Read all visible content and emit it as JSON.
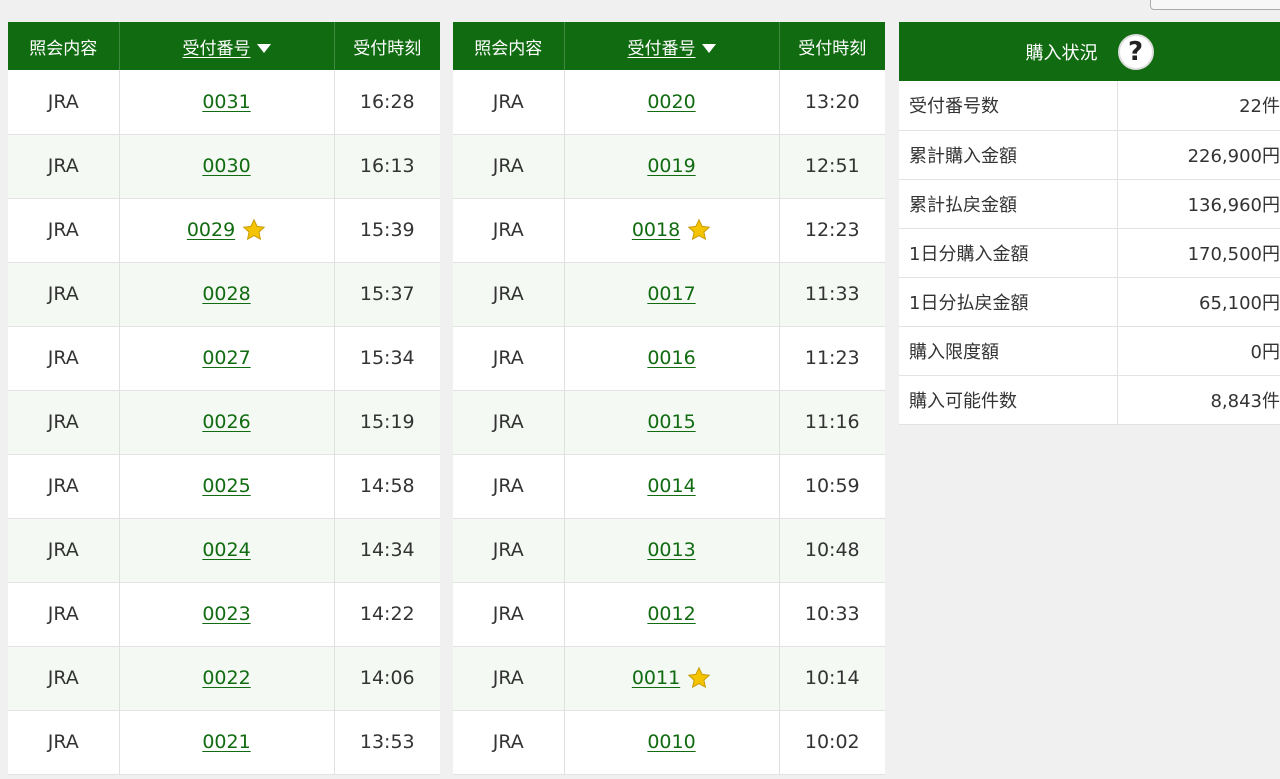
{
  "columns": {
    "inquiry": "照会内容",
    "receipt_number": "受付番号",
    "receipt_time": "受付時刻"
  },
  "left_rows": [
    {
      "type": "JRA",
      "number": "0031",
      "time": "16:28",
      "star": false
    },
    {
      "type": "JRA",
      "number": "0030",
      "time": "16:13",
      "star": false
    },
    {
      "type": "JRA",
      "number": "0029",
      "time": "15:39",
      "star": true
    },
    {
      "type": "JRA",
      "number": "0028",
      "time": "15:37",
      "star": false
    },
    {
      "type": "JRA",
      "number": "0027",
      "time": "15:34",
      "star": false
    },
    {
      "type": "JRA",
      "number": "0026",
      "time": "15:19",
      "star": false
    },
    {
      "type": "JRA",
      "number": "0025",
      "time": "14:58",
      "star": false
    },
    {
      "type": "JRA",
      "number": "0024",
      "time": "14:34",
      "star": false
    },
    {
      "type": "JRA",
      "number": "0023",
      "time": "14:22",
      "star": false
    },
    {
      "type": "JRA",
      "number": "0022",
      "time": "14:06",
      "star": false
    },
    {
      "type": "JRA",
      "number": "0021",
      "time": "13:53",
      "star": false
    }
  ],
  "right_rows": [
    {
      "type": "JRA",
      "number": "0020",
      "time": "13:20",
      "star": false
    },
    {
      "type": "JRA",
      "number": "0019",
      "time": "12:51",
      "star": false
    },
    {
      "type": "JRA",
      "number": "0018",
      "time": "12:23",
      "star": true
    },
    {
      "type": "JRA",
      "number": "0017",
      "time": "11:33",
      "star": false
    },
    {
      "type": "JRA",
      "number": "0016",
      "time": "11:23",
      "star": false
    },
    {
      "type": "JRA",
      "number": "0015",
      "time": "11:16",
      "star": false
    },
    {
      "type": "JRA",
      "number": "0014",
      "time": "10:59",
      "star": false
    },
    {
      "type": "JRA",
      "number": "0013",
      "time": "10:48",
      "star": false
    },
    {
      "type": "JRA",
      "number": "0012",
      "time": "10:33",
      "star": false
    },
    {
      "type": "JRA",
      "number": "0011",
      "time": "10:14",
      "star": true
    },
    {
      "type": "JRA",
      "number": "0010",
      "time": "10:02",
      "star": false
    }
  ],
  "status": {
    "title": "購入状況",
    "help_glyph": "?",
    "rows": [
      {
        "label": "受付番号数",
        "value": "22件"
      },
      {
        "label": "累計購入金額",
        "value": "226,900円"
      },
      {
        "label": "累計払戻金額",
        "value": "136,960円"
      },
      {
        "label": "1日分購入金額",
        "value": "170,500円"
      },
      {
        "label": "1日分払戻金額",
        "value": "65,100円"
      },
      {
        "label": "購入限度額",
        "value": "0円"
      },
      {
        "label": "購入可能件数",
        "value": "8,843件"
      }
    ]
  },
  "icons": {
    "sort": "sort-down-icon",
    "star": "star-icon",
    "help": "help-icon"
  },
  "colors": {
    "header_green": "#116b11",
    "link_green": "#116b11",
    "star_yellow": "#f5c400",
    "alt_row": "#f4f9f4"
  }
}
